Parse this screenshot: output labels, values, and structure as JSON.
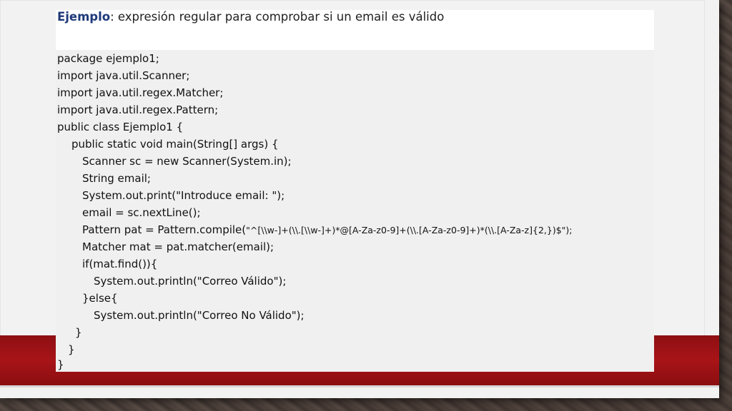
{
  "heading": {
    "keyword": "Ejemplo",
    "text": ": expresión regular para comprobar si un email es válido"
  },
  "code": {
    "lines": [
      "package ejemplo1;",
      "import java.util.Scanner;",
      "import java.util.regex.Matcher;",
      "import java.util.regex.Pattern;",
      "public class Ejemplo1 {",
      "public static void main(String[] args) {",
      "Scanner sc = new Scanner(System.in);",
      "String email;",
      "System.out.print(\"Introduce email: \");",
      "email = sc.nextLine();",
      "Pattern pat = Pattern.compile(",
      "Matcher mat = pat.matcher(email);",
      "if(mat.find()){",
      "System.out.println(\"Correo Válido\");",
      "}else{",
      "System.out.println(\"Correo No Válido\");",
      "}",
      "}",
      "}"
    ],
    "regex_literal": "\"^[\\\\w-]+(\\\\.[\\\\w-]+)*@[A-Za-z0-9]+(\\\\.[A-Za-z0-9]+)*(\\\\.[A-Za-z]{2,})$\");"
  }
}
